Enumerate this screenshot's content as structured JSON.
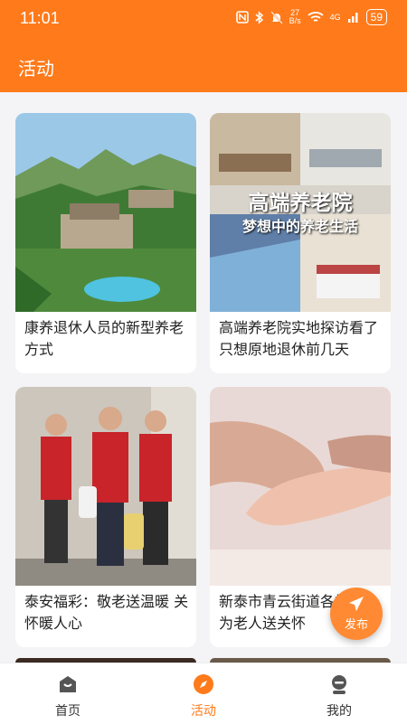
{
  "status_bar": {
    "time": "11:01",
    "net_speed_top": "27",
    "net_speed_bottom": "B/s",
    "signal": "4G",
    "battery": "59"
  },
  "header": {
    "title": "活动"
  },
  "cards": [
    {
      "caption": "康养退休人员的新型养老方式",
      "image": "mountain-resort-photo"
    },
    {
      "caption": "高端养老院实地探访看了只想原地退休前几天",
      "image": "nursing-home-collage",
      "overlay_title": "高端养老院",
      "overlay_subtitle": "梦想中的养老生活"
    },
    {
      "caption": "泰安福彩：敬老送温暖 关怀暖人心",
      "image": "volunteers-photo"
    },
    {
      "caption": "新泰市青云街道各社区）为老人送关怀",
      "image": "holding-hands-photo"
    }
  ],
  "fab": {
    "label": "发布",
    "icon": "send-icon"
  },
  "bottom_nav": [
    {
      "label": "首页",
      "icon": "home-icon",
      "active": false
    },
    {
      "label": "活动",
      "icon": "compass-icon",
      "active": true
    },
    {
      "label": "我的",
      "icon": "profile-icon",
      "active": false
    }
  ],
  "colors": {
    "accent": "#ff7a1a",
    "background": "#f4f4f6"
  }
}
